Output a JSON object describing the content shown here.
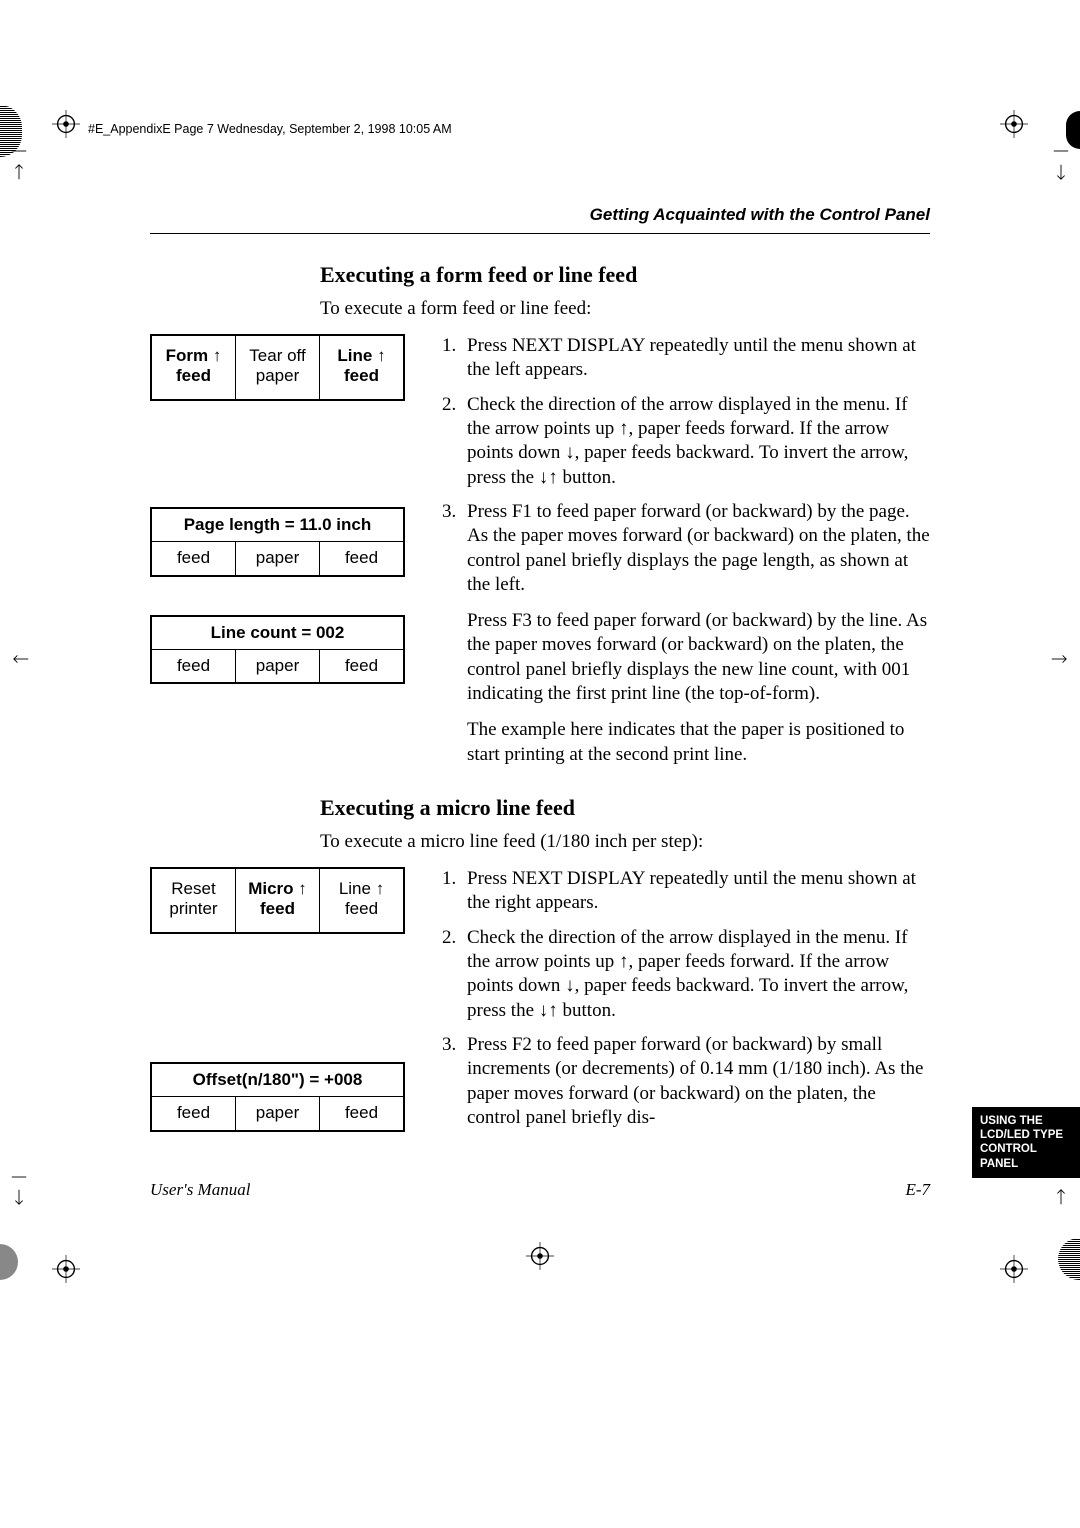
{
  "meta": {
    "file_header": "#E_AppendixE  Page 7  Wednesday, September 2, 1998  10:05 AM"
  },
  "header": {
    "running_title": "Getting Acquainted with the Control Panel"
  },
  "section1": {
    "title": "Executing a form feed or line feed",
    "intro": "To execute a form feed or line feed:",
    "steps": {
      "s1": "Press NEXT DISPLAY repeatedly until the menu shown at the left appears.",
      "s2": "Check the direction of the arrow displayed in the menu. If the arrow points up ↑, paper feeds forward. If the arrow points down ↓, paper feeds backward. To invert the arrow, press the ↓↑ button.",
      "s3": "Press F1 to feed paper forward (or backward) by the page. As the paper moves forward (or backward) on the platen, the control panel briefly displays the page length, as shown at the left.",
      "s3b": "Press F3 to feed paper forward (or backward) by the line. As the paper moves forward (or backward) on the platen, the control panel briefly displays the new line count, with 001 indicating the first print line (the top-of-form).",
      "s3c": "The example here indicates that the paper is positioned to start printing at the second print line."
    },
    "lcd1": {
      "c1a": "Form",
      "c1arrow": "↑",
      "c1b": "feed",
      "c2a": "Tear off",
      "c2b": "paper",
      "c3a": "Line",
      "c3arrow": "↑",
      "c3b": "feed"
    },
    "lcd2": {
      "title": "Page length = 11.0 inch",
      "b1": "feed",
      "b2": "paper",
      "b3": "feed"
    },
    "lcd3": {
      "title": "Line count = 002",
      "b1": "feed",
      "b2": "paper",
      "b3": "feed"
    }
  },
  "section2": {
    "title": "Executing a micro line feed",
    "intro": "To execute a micro line feed (1/180 inch per step):",
    "steps": {
      "s1": "Press NEXT DISPLAY repeatedly until the menu shown at the right appears.",
      "s2": "Check the direction of the arrow displayed in the menu. If the arrow points up ↑, paper feeds forward. If the arrow points down ↓, paper feeds backward. To invert the arrow, press the ↓↑ button.",
      "s3": "Press F2 to feed paper forward (or backward) by small increments (or decrements) of 0.14 mm (1/180 inch). As the paper moves forward (or backward) on the platen, the control panel briefly dis-"
    },
    "lcd1": {
      "c1a": "Reset",
      "c1b": "printer",
      "c2a": "Micro",
      "c2arrow": "↑",
      "c2b": "feed",
      "c3a": "Line",
      "c3arrow": "↑",
      "c3b": "feed"
    },
    "lcd2": {
      "title": "Offset(n/180\") = +008",
      "b1": "feed",
      "b2": "paper",
      "b3": "feed"
    }
  },
  "footer": {
    "left": "User's Manual",
    "right": "E-7"
  },
  "sidetab": {
    "l1": "USING THE",
    "l2": "LCD/LED TYPE",
    "l3": "CONTROL PANEL"
  }
}
